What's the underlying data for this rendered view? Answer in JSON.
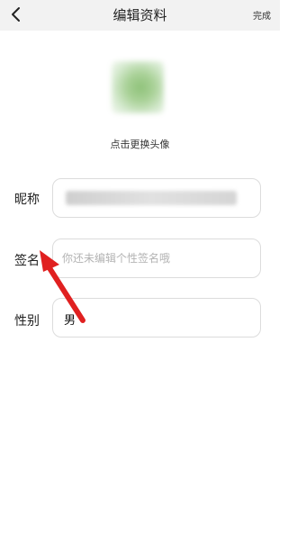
{
  "header": {
    "title": "编辑资料",
    "done_label": "完成"
  },
  "avatar": {
    "caption": "点击更换头像"
  },
  "form": {
    "nickname": {
      "label": "昵称",
      "value": ""
    },
    "signature": {
      "label": "签名",
      "placeholder": "你还未编辑个性签名哦",
      "value": ""
    },
    "gender": {
      "label": "性别",
      "value": "男"
    }
  },
  "annotation": {
    "arrow_color": "#e02020",
    "points_to": "签名"
  },
  "colors": {
    "header_bg": "#f2f2f2",
    "field_border": "#dcdcdc",
    "placeholder": "#b3b3b3"
  }
}
